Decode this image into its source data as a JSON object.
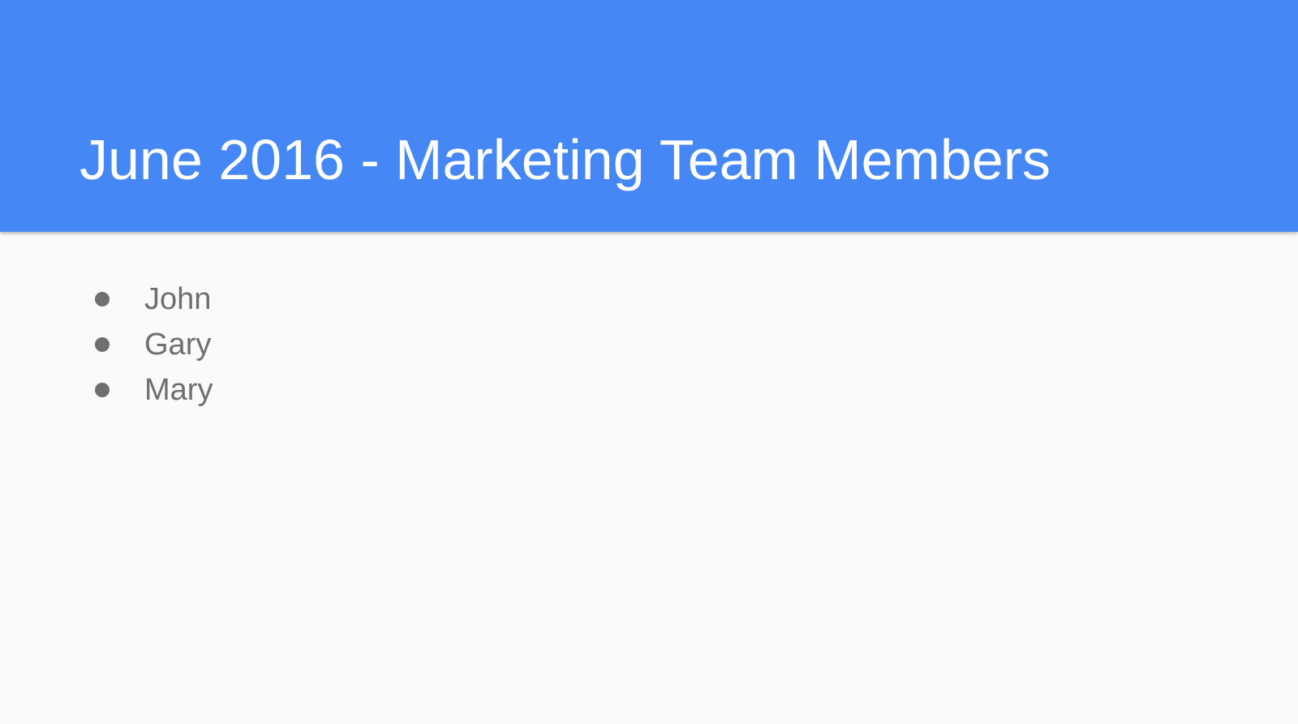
{
  "slide": {
    "title": "June 2016 - Marketing Team Members",
    "members": [
      "John",
      "Gary",
      "Mary"
    ]
  },
  "colors": {
    "header_background": "#4587f5",
    "body_background": "#fafafa",
    "title_text": "#ffffff",
    "list_text": "#6f6f6f"
  }
}
